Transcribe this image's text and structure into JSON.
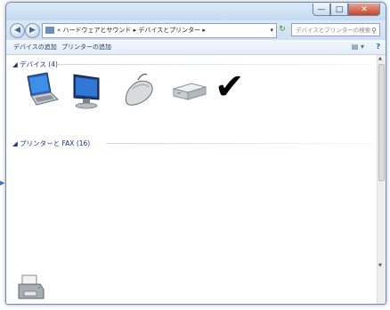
{
  "window": {
    "min_label": "—",
    "max_label": "□",
    "close_label": "✕"
  },
  "nav": {
    "back_icon": "◀",
    "forward_icon": "▶"
  },
  "address": {
    "prefix": "«",
    "crumb1": "ハードウェアとサウンド",
    "sep": "▸",
    "crumb2": "デバイスとプリンター",
    "sep2": "▸",
    "dropdown": "▾"
  },
  "refresh_icon": "↻",
  "search": {
    "placeholder": "デバイスとプリンターの検索",
    "icon": "⚲"
  },
  "toolbar": {
    "add_device": "デバイスの追加",
    "add_printer": "プリンターの追加",
    "view_icon": "▤ ▾",
    "help_icon": "?"
  },
  "groups": {
    "devices_header": "◢ デバイス (4)",
    "printers_header": "◢ プリンターと FAX (16)"
  },
  "devices": [
    {
      "name": "laptop-icon"
    },
    {
      "name": "monitor-icon"
    },
    {
      "name": "mouse-icon"
    },
    {
      "name": "drive-icon"
    },
    {
      "name": "checkmark-icon"
    }
  ],
  "checkmark_glyph": "✔",
  "side_arrow": "▶",
  "colors": {
    "title_bg": "#cfe2f3",
    "group_header": "#1e3287",
    "close_button": "#c4432a"
  }
}
